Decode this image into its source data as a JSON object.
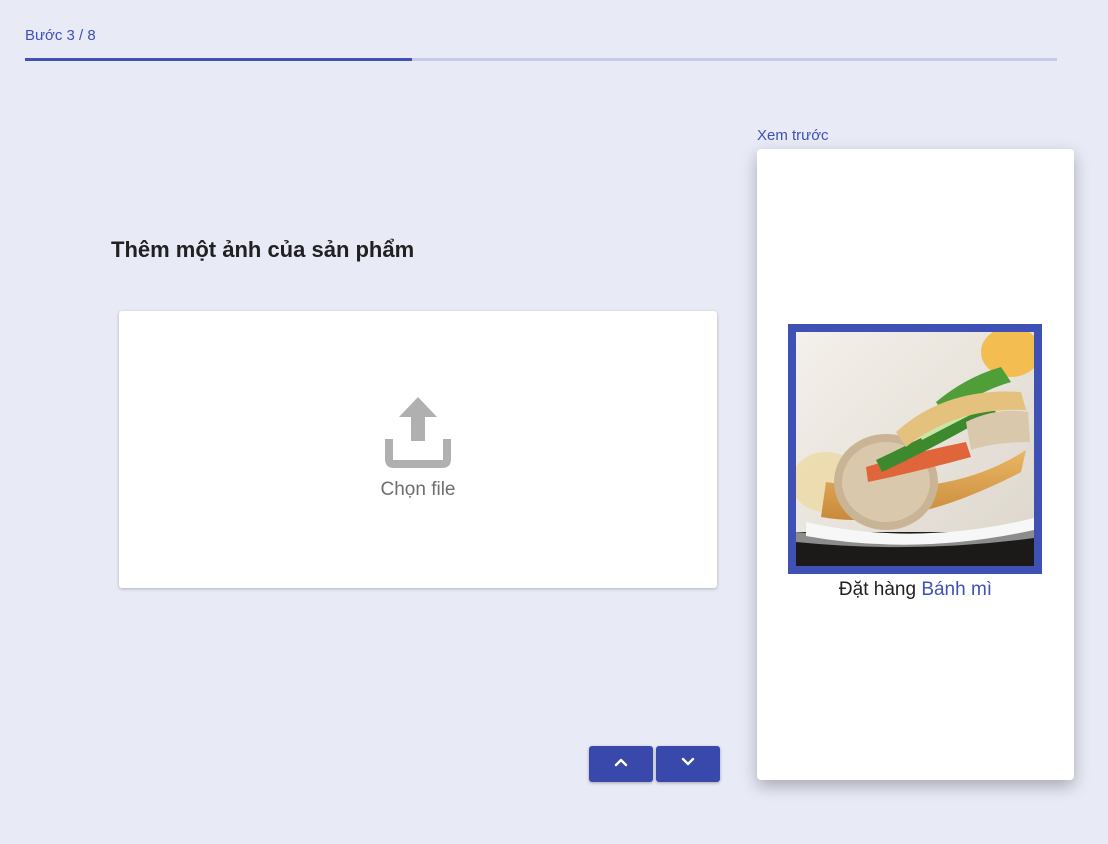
{
  "progress": {
    "step_label": "Bước 3 / 8",
    "current_step": 3,
    "total_steps": 8,
    "fill_fraction": 0.375
  },
  "main": {
    "title": "Thêm một ảnh của sản phẩm",
    "upload": {
      "label": "Chọn file",
      "icon": "upload-icon"
    }
  },
  "navigation": {
    "prev_icon": "chevron-up-icon",
    "next_icon": "chevron-down-icon"
  },
  "preview": {
    "label": "Xem trước",
    "caption_prefix": "Đặt hàng",
    "product_name": "Bánh mì",
    "image": "banh-mi-sandwich-photo"
  },
  "colors": {
    "background": "#e8eaf6",
    "accent": "#3f51b5",
    "button": "#3949ab",
    "track": "#c5cae9"
  }
}
